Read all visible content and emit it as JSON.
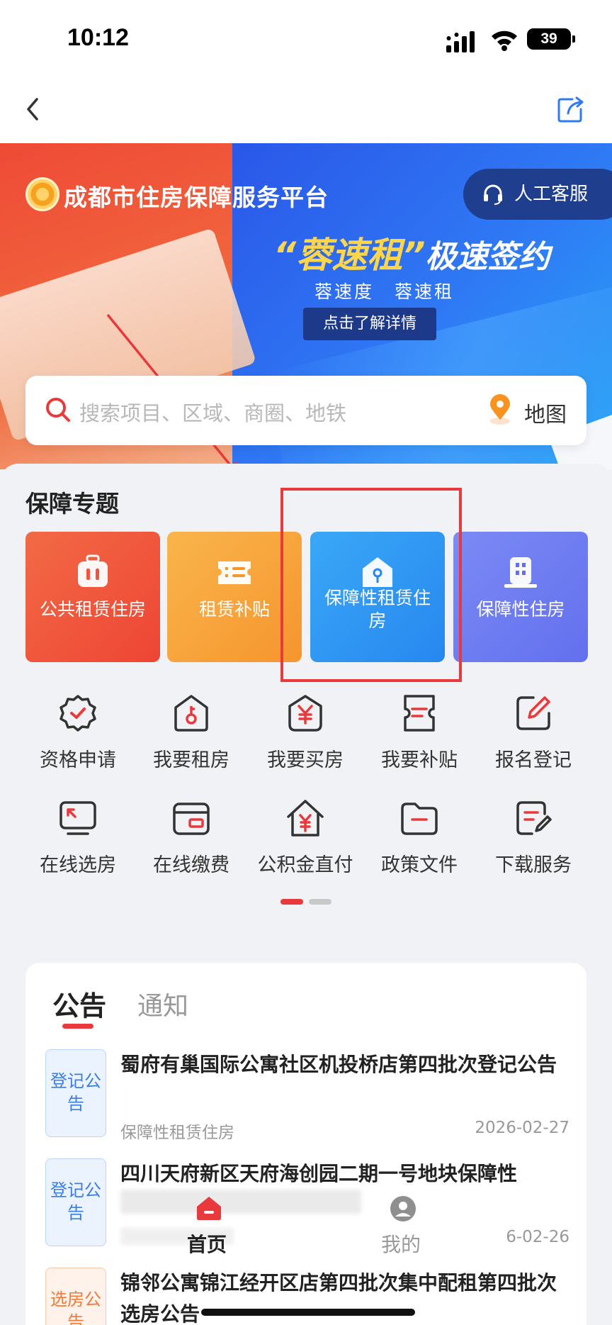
{
  "status_bar": {
    "time": "10:12",
    "battery": "39"
  },
  "banner": {
    "platform_title": "成都市住房保障服务平台",
    "service_button": "人工客服",
    "headline": "“蓉速租”",
    "headline_b": "极速签约",
    "sub_headline": "蓉速度 蓉速租",
    "detail_button": "点击了解详情"
  },
  "search": {
    "placeholder": "搜索项目、区域、商圈、地铁",
    "map_label": "地图"
  },
  "topics": {
    "title": "保障专题",
    "cards": [
      {
        "label": "公共租赁住房",
        "color": "#f2533a",
        "icon": "suitcase-icon"
      },
      {
        "label": "租赁补贴",
        "color": "#f7a23a",
        "icon": "ticket-icon"
      },
      {
        "label": "保障性租赁住房",
        "color": "#2f95f2",
        "icon": "house-key-icon"
      },
      {
        "label": "保障性住房",
        "color": "#6f7df0",
        "icon": "building-icon"
      }
    ]
  },
  "services": [
    {
      "label": "资格申请",
      "icon": "badge-check-icon"
    },
    {
      "label": "我要租房",
      "icon": "house-key-icon"
    },
    {
      "label": "我要买房",
      "icon": "yuan-icon"
    },
    {
      "label": "我要补贴",
      "icon": "voucher-icon"
    },
    {
      "label": "报名登记",
      "icon": "edit-icon"
    },
    {
      "label": "在线选房",
      "icon": "monitor-icon"
    },
    {
      "label": "在线缴费",
      "icon": "wallet-icon"
    },
    {
      "label": "公积金直付",
      "icon": "house-yuan-icon"
    },
    {
      "label": "政策文件",
      "icon": "folder-icon"
    },
    {
      "label": "下载服务",
      "icon": "document-edit-icon"
    }
  ],
  "notices": {
    "tabs": [
      "公告",
      "通知"
    ],
    "items": [
      {
        "tag": "登记公告",
        "tag_color": "blue",
        "title": "蜀府有巢国际公寓社区机投桥店第四批次登记公告",
        "category": "保障性租赁住房",
        "date": "2026-02-27"
      },
      {
        "tag": "登记公告",
        "tag_color": "blue",
        "title": "四川天府新区天府海创园二期一号地块保障性",
        "category": "",
        "date": "6-02-26"
      },
      {
        "tag": "选房公告",
        "tag_color": "orange",
        "title": "锦邻公寓锦江经开区店第四批次集中配租第四批次选房公告",
        "category": "",
        "date": ""
      }
    ]
  },
  "tabbar": {
    "home": "首页",
    "me": "我的"
  },
  "colors": {
    "accent": "#e8393d",
    "primary_blue": "#2f7af5"
  }
}
